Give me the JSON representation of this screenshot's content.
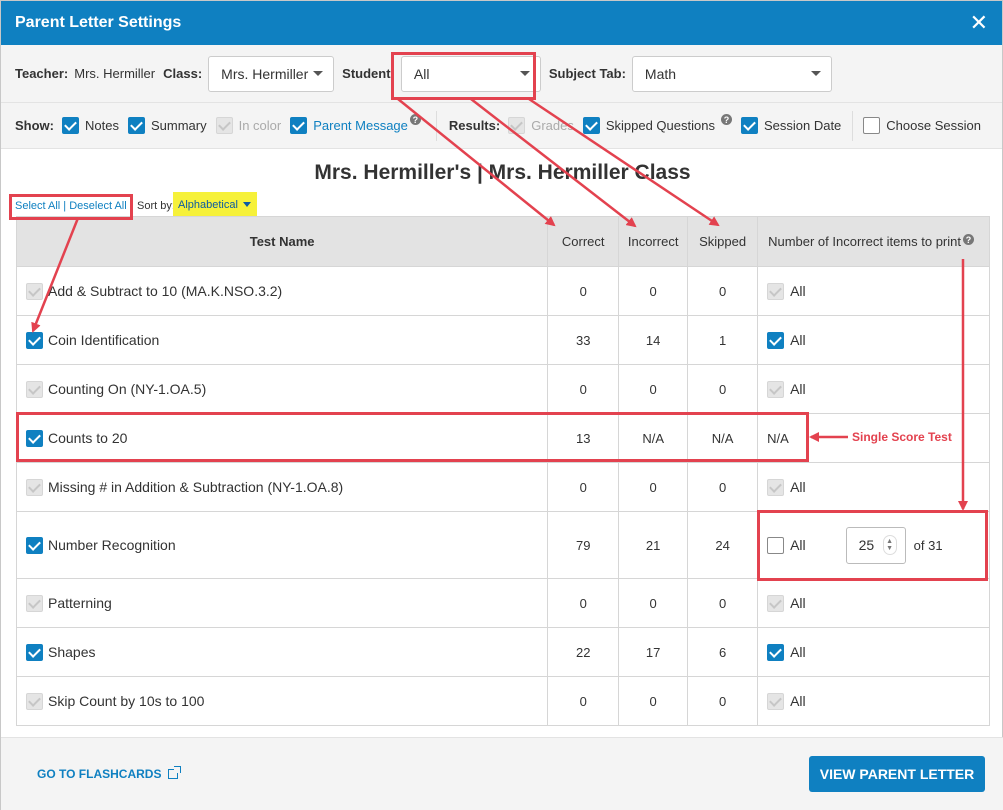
{
  "dialog": {
    "title": "Parent Letter Settings"
  },
  "filters": {
    "teacher_label": "Teacher:",
    "teacher_value": "Mrs. Hermiller",
    "class_label": "Class:",
    "class_value": "Mrs. Hermiller",
    "student_label": "Student:",
    "student_value": "All",
    "subject_label": "Subject Tab:",
    "subject_value": "Math"
  },
  "show": {
    "label": "Show:",
    "notes": "Notes",
    "summary": "Summary",
    "in_color": "In color",
    "parent_message": "Parent Message"
  },
  "results": {
    "label": "Results:",
    "grades": "Grades",
    "skipped_questions": "Skipped Questions",
    "session_date": "Session Date",
    "choose_session": "Choose Session"
  },
  "page_title": "Mrs. Hermiller's | Mrs. Hermiller Class",
  "select_all": "Select All | Deselect All",
  "sort_label": "Sort by:",
  "sort_value": "Alphabetical",
  "table": {
    "headers": {
      "test_name": "Test Name",
      "correct": "Correct",
      "incorrect": "Incorrect",
      "skipped": "Skipped",
      "incorrect_items": "Number of Incorrect items to print"
    },
    "rows": [
      {
        "name": "Add & Subtract to 10 (MA.K.NSO.3.2)",
        "correct": "0",
        "incorrect": "0",
        "skipped": "0",
        "all": "All"
      },
      {
        "name": "Coin Identification",
        "correct": "33",
        "incorrect": "14",
        "skipped": "1",
        "all": "All"
      },
      {
        "name": "Counting On (NY-1.OA.5)",
        "correct": "0",
        "incorrect": "0",
        "skipped": "0",
        "all": "All"
      },
      {
        "name": "Counts to 20",
        "correct": "13",
        "incorrect": "N/A",
        "skipped": "N/A",
        "all": "N/A"
      },
      {
        "name": "Missing # in Addition & Subtraction (NY-1.OA.8)",
        "correct": "0",
        "incorrect": "0",
        "skipped": "0",
        "all": "All"
      },
      {
        "name": "Number Recognition",
        "correct": "79",
        "incorrect": "21",
        "skipped": "24",
        "all": "All",
        "count": "25",
        "of": "of 31"
      },
      {
        "name": "Patterning",
        "correct": "0",
        "incorrect": "0",
        "skipped": "0",
        "all": "All"
      },
      {
        "name": "Shapes",
        "correct": "22",
        "incorrect": "17",
        "skipped": "6",
        "all": "All"
      },
      {
        "name": "Skip Count by 10s to 100",
        "correct": "0",
        "incorrect": "0",
        "skipped": "0",
        "all": "All"
      }
    ]
  },
  "annotation": {
    "single_score": "Single Score Test"
  },
  "footer": {
    "flashcards": "GO TO FLASHCARDS",
    "view_letter": "VIEW PARENT LETTER"
  },
  "colors": {
    "primary": "#0f80c1",
    "annotation_red": "#e3424f",
    "highlight_yellow": "#f6f13a"
  }
}
